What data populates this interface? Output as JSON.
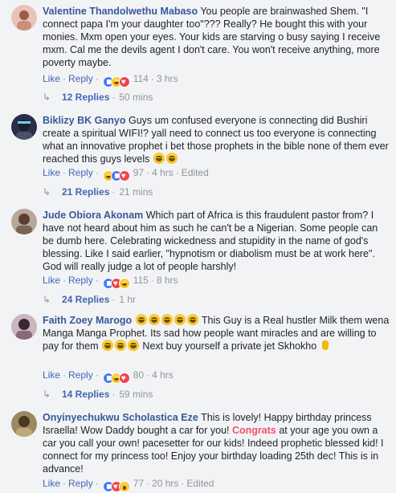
{
  "comments": [
    {
      "author": "Valentine Thandolwethu Mabaso",
      "text": " You people are brainwashed Shem. \"I connect papa I'm your daughter too\"??? Really? He bought this with your monies. Mxm open your eyes. Your kids are starving o busy saying I receive mxm. Cal me the devils agent I don't care. You won't receive anything, more poverty maybe.",
      "like": "Like",
      "reply": "Reply",
      "reaction_count": "114",
      "time": "3 hrs",
      "edited": "",
      "replies_label": "12 Replies",
      "replies_time": "50 mins",
      "avatar_color": "#d9a59a"
    },
    {
      "author": "Biklizy BK Ganyo",
      "text": " Guys um confused everyone is connecting did Bushiri create a spiritual WIFI!? yall need to connect us too everyone is connecting what an innovative prophet i bet those prophets in the bible none of them ever reached this guys levels ",
      "like": "Like",
      "reply": "Reply",
      "reaction_count": "97",
      "time": "4 hrs",
      "edited": "Edited",
      "replies_label": "21 Replies",
      "replies_time": "21 mins",
      "avatar_color": "#3a3f5c"
    },
    {
      "author": "Jude Obiora Akonam",
      "text": " Which part of Africa is this fraudulent pastor from? I have not heard about him as such he can't be a Nigerian. Some people can be dumb here. Celebrating wickedness and stupidity in the name of god's blessing. Like I said earlier, \"hypnotism or diabolism must be at work here\". God will really judge a lot of people harshly!",
      "like": "Like",
      "reply": "Reply",
      "reaction_count": "115",
      "time": "8 hrs",
      "edited": "",
      "replies_label": "24 Replies",
      "replies_time": "1 hr",
      "avatar_color": "#8a7568"
    },
    {
      "author": "Faith Zoey Marogo",
      "text_a": " This Guy is a Real hustler Milk them wena Manga Manga Prophet. Its sad how people want miracles and are willing to pay for them ",
      "text_b": " Next buy yourself a private jet Skhokho",
      "like": "Like",
      "reply": "Reply",
      "reaction_count": "80",
      "time": "4 hrs",
      "edited": "",
      "replies_label": "14 Replies",
      "replies_time": "59 mins",
      "avatar_color": "#6b4f5c"
    },
    {
      "author": "Onyinyechukwu Scholastica Eze",
      "text_a": " This is lovely! Happy birthday princess Israella! Wow Daddy bought a car for you! ",
      "highlight": "Congrats",
      "text_b": " at your age you own a car you call your own! pacesetter for our kids! Indeed prophetic blessed kid! I connect for my princess too! Enjoy your birthday loading 25th dec! This is in advance!",
      "like": "Like",
      "reply": "Reply",
      "reaction_count": "77",
      "time": "20 hrs",
      "edited": "Edited",
      "avatar_color": "#7a6a4a"
    }
  ]
}
